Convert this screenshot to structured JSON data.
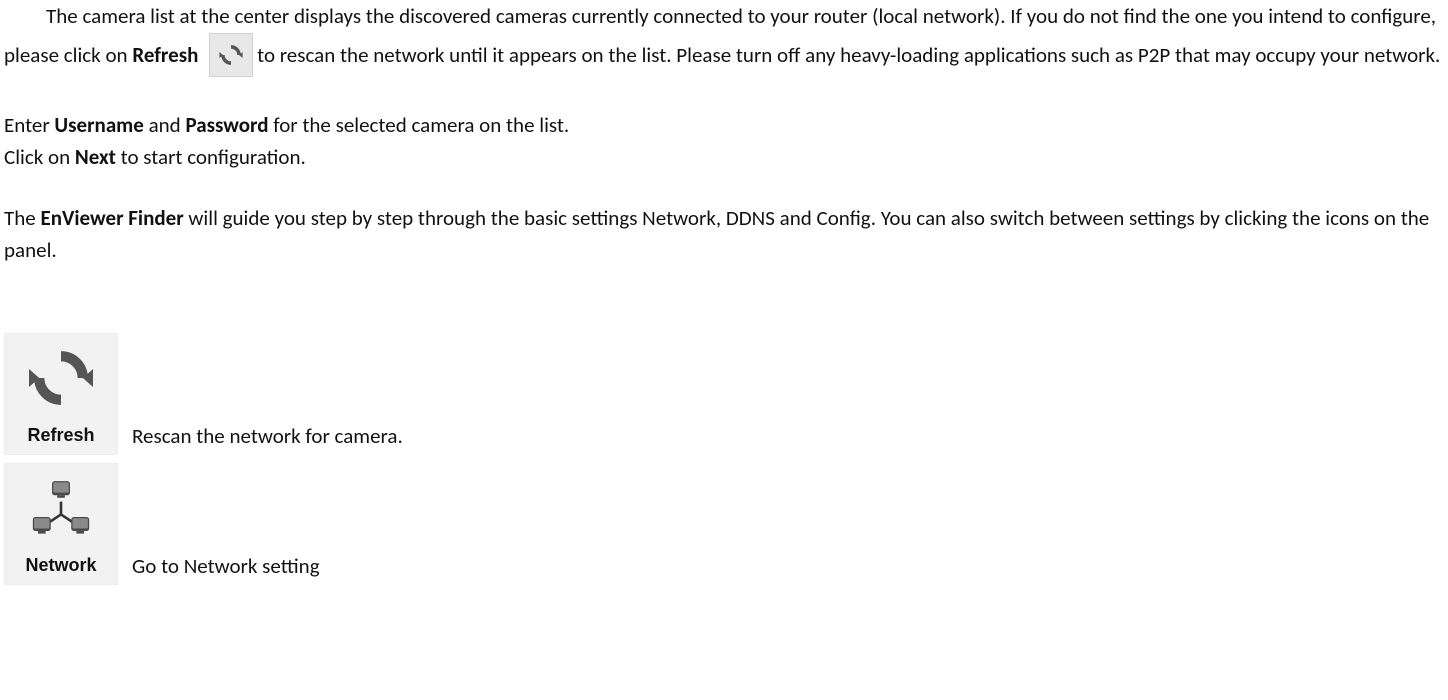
{
  "paragraph1": {
    "t1": "The camera list at the center displays the discovered cameras currently connected to your router (local network). If you do not find the one you intend to configure, please click on ",
    "refresh_bold": "Refresh",
    "t2": "to rescan the network until it appears on the list. Please turn off any heavy-loading applications such as P2P that may occupy your network."
  },
  "paragraph2": {
    "t1": "Enter ",
    "username_bold": "Username",
    "t2": " and ",
    "password_bold": "Password",
    "t3": " for the selected camera on the list."
  },
  "paragraph3": {
    "t1": "Click on ",
    "next_bold": "Next",
    "t2": " to start configuration."
  },
  "paragraph4": {
    "t1": "The ",
    "app_bold": "EnViewer Finder",
    "t2": " will guide you step by step through the basic settings Network, DDNS and Config. You can also switch between settings by clicking the icons on the panel."
  },
  "icons": {
    "refresh": {
      "caption": "Refresh",
      "desc": "Rescan the network for camera."
    },
    "network": {
      "caption": "Network",
      "desc": "Go to Network setting"
    }
  }
}
